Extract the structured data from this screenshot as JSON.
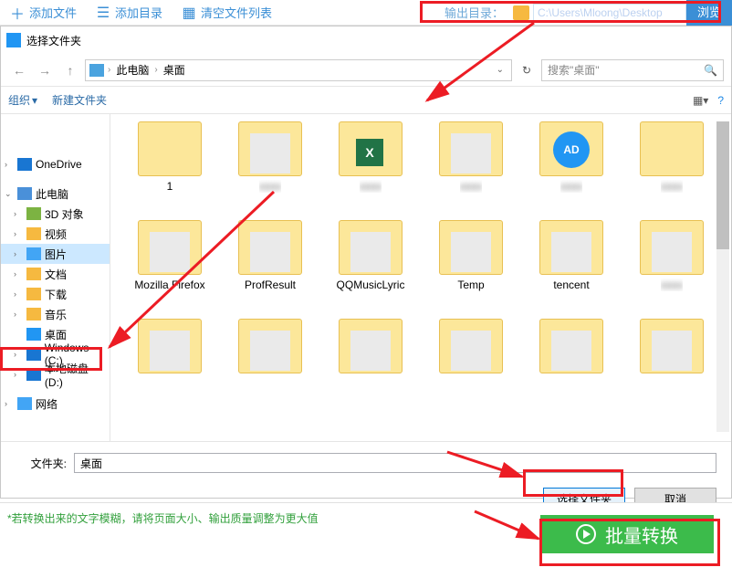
{
  "toolbar": {
    "add_file": "添加文件",
    "add_dir": "添加目录",
    "clear_list": "清空文件列表",
    "output_label": "输出目录：",
    "output_path": "C:\\Users\\Mloong\\Desktop",
    "browse": "浏览"
  },
  "dialog": {
    "title": "选择文件夹",
    "breadcrumb": {
      "root": "此电脑",
      "current": "桌面"
    },
    "search_placeholder": "搜索\"桌面\"",
    "org_label": "组织",
    "new_folder": "新建文件夹",
    "tree": [
      {
        "label": "OneDrive",
        "icon": "drive",
        "indent": 1
      },
      {
        "label": "此电脑",
        "icon": "pc",
        "indent": 1
      },
      {
        "label": "3D 对象",
        "icon": "green",
        "indent": 2
      },
      {
        "label": "视频",
        "icon": "folder",
        "indent": 2
      },
      {
        "label": "图片",
        "icon": "blue",
        "indent": 2,
        "sel": true
      },
      {
        "label": "文档",
        "icon": "folder",
        "indent": 2
      },
      {
        "label": "下载",
        "icon": "folder",
        "indent": 2
      },
      {
        "label": "音乐",
        "icon": "folder",
        "indent": 2
      },
      {
        "label": "桌面",
        "icon": "desktop",
        "indent": 2,
        "highlight": true
      },
      {
        "label": "Windows (C:)",
        "icon": "drive",
        "indent": 2
      },
      {
        "label": "本地磁盘 (D:)",
        "icon": "drive",
        "indent": 2
      },
      {
        "label": "网络",
        "icon": "blue",
        "indent": 1
      }
    ],
    "items_row1": [
      {
        "label": "1",
        "thumb": ""
      },
      {
        "label": "",
        "thumb": "overlay",
        "blur": true
      },
      {
        "label": "",
        "thumb": "excel",
        "blur": true
      },
      {
        "label": "",
        "thumb": "overlay",
        "blur": true
      },
      {
        "label": "",
        "thumb": "ad",
        "blur": true
      },
      {
        "label": "",
        "thumb": "",
        "blur": true
      }
    ],
    "items_row2": [
      {
        "label": "Mozilla Firefox",
        "thumb": "overlay"
      },
      {
        "label": "ProfResult",
        "thumb": "overlay"
      },
      {
        "label": "QQMusicLyric",
        "thumb": "overlay"
      },
      {
        "label": "Temp",
        "thumb": "overlay"
      },
      {
        "label": "tencent",
        "thumb": "overlay"
      },
      {
        "label": "",
        "thumb": "overlay",
        "blur": true
      }
    ],
    "folder_field_label": "文件夹:",
    "folder_field_value": "桌面",
    "select_btn": "选择文件夹",
    "cancel_btn": "取消"
  },
  "bottom": {
    "hint": "*若转换出来的文字模糊，请将页面大小、输出质量调整为更大值",
    "batch": "批量转换"
  }
}
